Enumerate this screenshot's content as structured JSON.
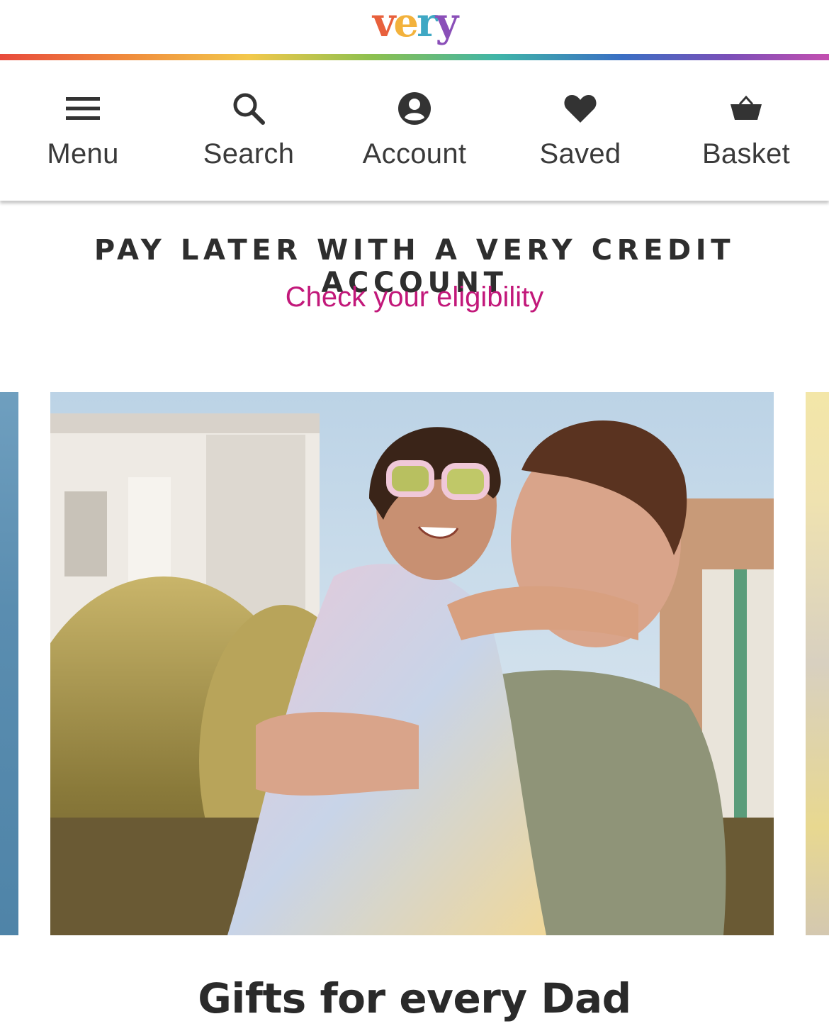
{
  "header": {
    "logo_text": "very",
    "logo_colors": [
      "#e8603c",
      "#f3b23c",
      "#3fa8c4",
      "#8a4fb8"
    ]
  },
  "nav": {
    "items": [
      {
        "label": "Menu",
        "icon": "menu-icon"
      },
      {
        "label": "Search",
        "icon": "search-icon"
      },
      {
        "label": "Account",
        "icon": "account-icon"
      },
      {
        "label": "Saved",
        "icon": "heart-icon"
      },
      {
        "label": "Basket",
        "icon": "basket-icon"
      }
    ]
  },
  "promo": {
    "title": "PAY LATER WITH A VERY CREDIT ACCOUNT",
    "link": "Check your eligibility",
    "link_color": "#c2187a"
  },
  "carousel": {
    "main_slide_caption": "Gifts for every Dad"
  }
}
